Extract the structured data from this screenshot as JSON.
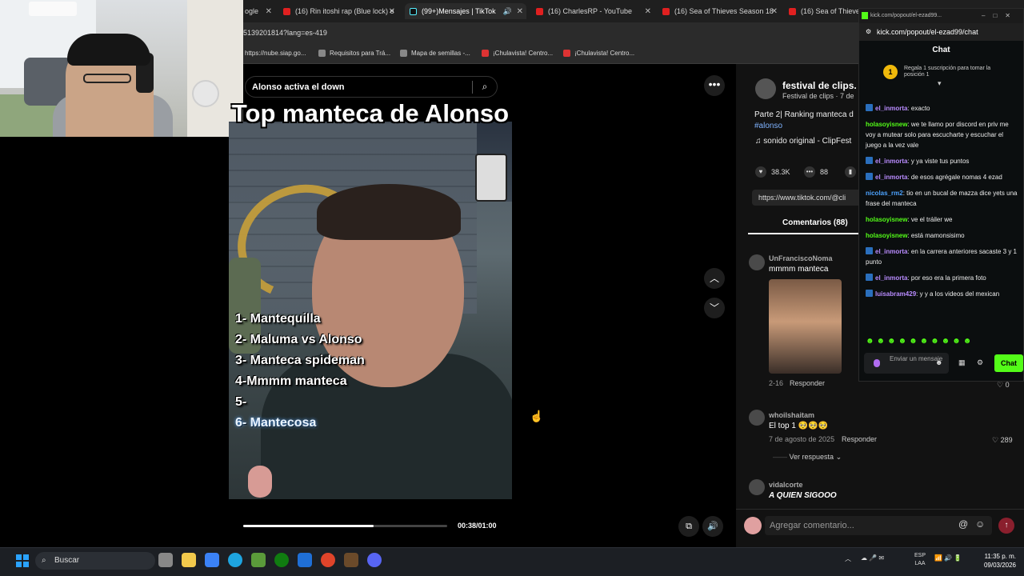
{
  "browser": {
    "tabs": [
      {
        "label": "ogle",
        "type": "generic"
      },
      {
        "label": "(16) Rin itoshi rap (Blue lock) e",
        "type": "youtube"
      },
      {
        "label": "(99+)Mensajes | TikTok",
        "type": "tiktok"
      },
      {
        "label": "(16) CharlesRP - YouTube",
        "type": "youtube"
      },
      {
        "label": "(16) Sea of Thieves Season 18",
        "type": "youtube"
      },
      {
        "label": "(16) Sea of Thieves: A",
        "type": "youtube"
      }
    ],
    "url": "5139201814?lang=es-419",
    "bookmarks": [
      "https://nube.siap.go...",
      "Requisitos para Trá...",
      "Mapa de semillas -...",
      "¡Chulavista! Centro...",
      "¡Chulavista! Centro..."
    ]
  },
  "video": {
    "search_text": "Alonso activa el down",
    "overlay_title": "Top manteca de Alonso",
    "list": [
      "1- Mantequilla",
      "2- Maluma vs Alonso",
      "3- Manteca spideman",
      "4-Mmmm manteca",
      "5-",
      "6- Mantecosa"
    ],
    "time": "00:38/01:00",
    "progress_fraction": 0.64
  },
  "post": {
    "channel": "festival de clips.",
    "channel_sub": "Festival de clips · 7 de",
    "description": "Parte 2| Ranking manteca d",
    "hashtag": "#alonso",
    "sound": "sonido original - ClipFest",
    "likes": "38.3K",
    "comments": "88",
    "link": "https://www.tiktok.com/@cli",
    "comments_tab": "Comentarios (88)"
  },
  "comments": [
    {
      "user": "UnFranciscoNoma",
      "text": "mmmm manteca",
      "date": "2-16",
      "reply": "Responder",
      "likes": "0"
    },
    {
      "user": "whoilshaitam",
      "text": "El top 1 🥺🥺🥺",
      "date": "7 de agosto de 2025",
      "reply": "Responder",
      "likes": "289"
    },
    {
      "user": "vidalcorte",
      "text": "A QUIEN SIGOOO"
    }
  ],
  "view_replies": "Ver respuesta",
  "comment_placeholder": "Agregar comentario...",
  "kick": {
    "window_title": "kick.com/popout/el-ezad99...",
    "url": "kick.com/popout/el-ezad99/chat",
    "header": "Chat",
    "promo": "Regala 1 suscripción para tomar la posición 1",
    "promo_rank": "1",
    "messages": [
      {
        "user": "el_inmorta",
        "text": "exacto",
        "color": "#b98cff",
        "badge": true
      },
      {
        "user": "holasoyisnew",
        "text": "we te llamo por discord en priv me voy a mutear solo para escucharte y escuchar el juego a la vez vale",
        "color": "#53fc18",
        "badge": false
      },
      {
        "user": "el_inmorta",
        "text": "y ya viste tus puntos",
        "color": "#b98cff",
        "badge": true
      },
      {
        "user": "el_inmorta",
        "text": "de esos agrégale nomas 4 ezad",
        "color": "#b98cff",
        "badge": true
      },
      {
        "user": "nicolas_rm2",
        "text": "tio en un bucal de mazza dice yets una frase del manteca",
        "color": "#4da3ff",
        "badge": false
      },
      {
        "user": "holasoyisnew",
        "text": "ve el tráiler we",
        "color": "#53fc18",
        "badge": false
      },
      {
        "user": "holasoyisnew",
        "text": "está mamonsisimo",
        "color": "#53fc18",
        "badge": false
      },
      {
        "user": "el_inmorta",
        "text": "en la carrera anteriores sacaste 3 y 1 punto",
        "color": "#b98cff",
        "badge": true
      },
      {
        "user": "el_inmorta",
        "text": "por eso era la primera foto",
        "color": "#b98cff",
        "badge": true
      },
      {
        "user": "luisabram429",
        "text": "y y a los videos del mexican",
        "color": "#b98cff",
        "badge": true
      }
    ],
    "input_placeholder": "Enviar un mensaje",
    "chat_button": "Chat"
  },
  "taskbar": {
    "search": "Buscar",
    "lang": "ESP LAA",
    "time": "11:35 p. m.",
    "date": "09/03/2026"
  }
}
